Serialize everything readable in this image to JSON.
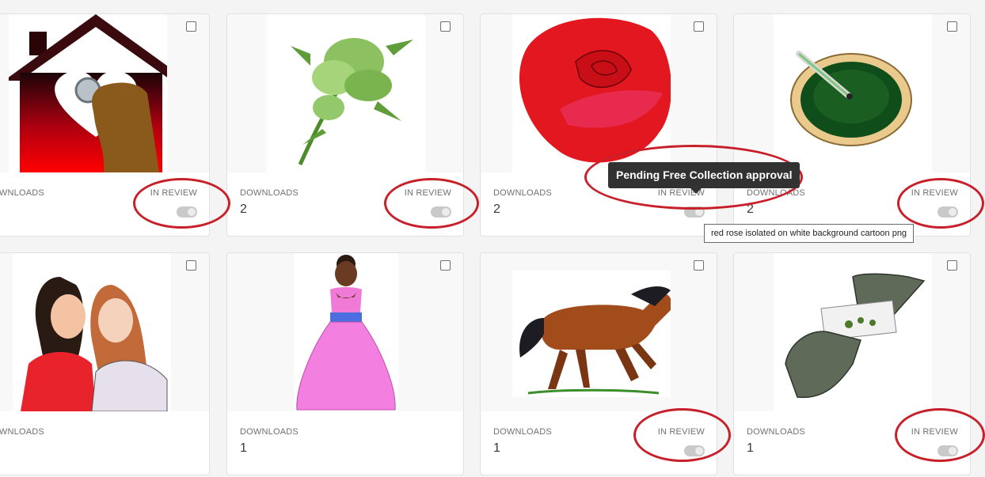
{
  "cards": [
    {
      "name": "house-heart-stethoscope",
      "downloads_label": "DOWNLOADS",
      "downloads_count": "",
      "status": "IN REVIEW"
    },
    {
      "name": "cannabis-plant",
      "downloads_label": "DOWNLOADS",
      "downloads_count": "2",
      "status": "IN REVIEW"
    },
    {
      "name": "red-rose",
      "downloads_label": "DOWNLOADS",
      "downloads_count": "2",
      "status": "IN REVIEW"
    },
    {
      "name": "ashtray-joint",
      "downloads_label": "DOWNLOADS",
      "downloads_count": "2",
      "status": "IN REVIEW"
    },
    {
      "name": "two-women-whispering",
      "downloads_label": "DOWNLOADS",
      "downloads_count": "",
      "status": ""
    },
    {
      "name": "girl-pink-gown",
      "downloads_label": "DOWNLOADS",
      "downloads_count": "1",
      "status": ""
    },
    {
      "name": "running-horse",
      "downloads_label": "DOWNLOADS",
      "downloads_count": "1",
      "status": "IN REVIEW"
    },
    {
      "name": "hands-rolling-paper",
      "downloads_label": "DOWNLOADS",
      "downloads_count": "1",
      "status": "IN REVIEW"
    }
  ],
  "tooltip": {
    "text": "Pending Free Collection approval"
  },
  "title_hint": {
    "text": "red rose isolated on white background cartoon png"
  },
  "colors": {
    "annotation": "#c8202a",
    "tooltip_bg": "#323232",
    "toggle": "#c9c9c9"
  }
}
